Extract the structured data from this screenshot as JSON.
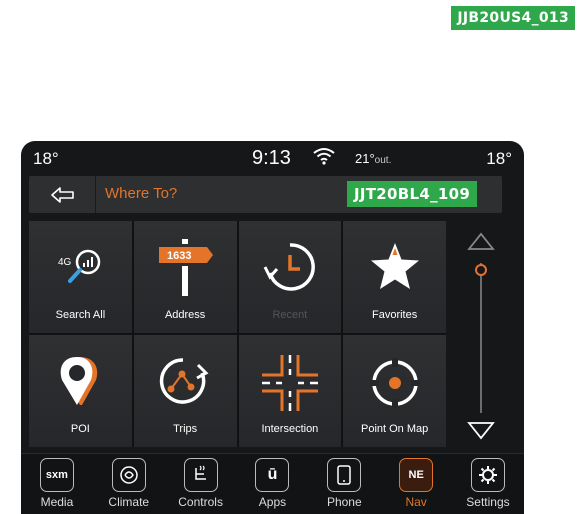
{
  "tags": {
    "top": "JJB20US4_013",
    "mid": "JJT20BL4_109"
  },
  "status": {
    "temp_left": "18°",
    "clock": "9:13",
    "outside_temp": "21°",
    "outside_label": "out.",
    "temp_right": "18°"
  },
  "header": {
    "title": "Where To?"
  },
  "tiles": [
    {
      "label": "Search All",
      "icon": "search-4g-icon"
    },
    {
      "label": "Address",
      "icon": "signpost-icon",
      "sign_number": "1633"
    },
    {
      "label": "Recent",
      "icon": "clock-history-icon",
      "disabled": true
    },
    {
      "label": "Favorites",
      "icon": "star-icon"
    },
    {
      "label": "POI",
      "icon": "map-pin-icon"
    },
    {
      "label": "Trips",
      "icon": "route-icon"
    },
    {
      "label": "Intersection",
      "icon": "intersection-icon"
    },
    {
      "label": "Point On Map",
      "icon": "crosshair-icon"
    }
  ],
  "search_badge": "4G",
  "dock": [
    {
      "label": "Media",
      "icon_text": "sxm"
    },
    {
      "label": "Climate",
      "icon_text": ""
    },
    {
      "label": "Controls",
      "icon_text": ""
    },
    {
      "label": "Apps",
      "icon_text": "ū"
    },
    {
      "label": "Phone",
      "icon_text": ""
    },
    {
      "label": "Nav",
      "icon_text": "NE",
      "active": true
    },
    {
      "label": "Settings",
      "icon_text": ""
    }
  ],
  "colors": {
    "accent": "#e3742a",
    "tag_green": "#2ea84a",
    "background": "#161718"
  }
}
